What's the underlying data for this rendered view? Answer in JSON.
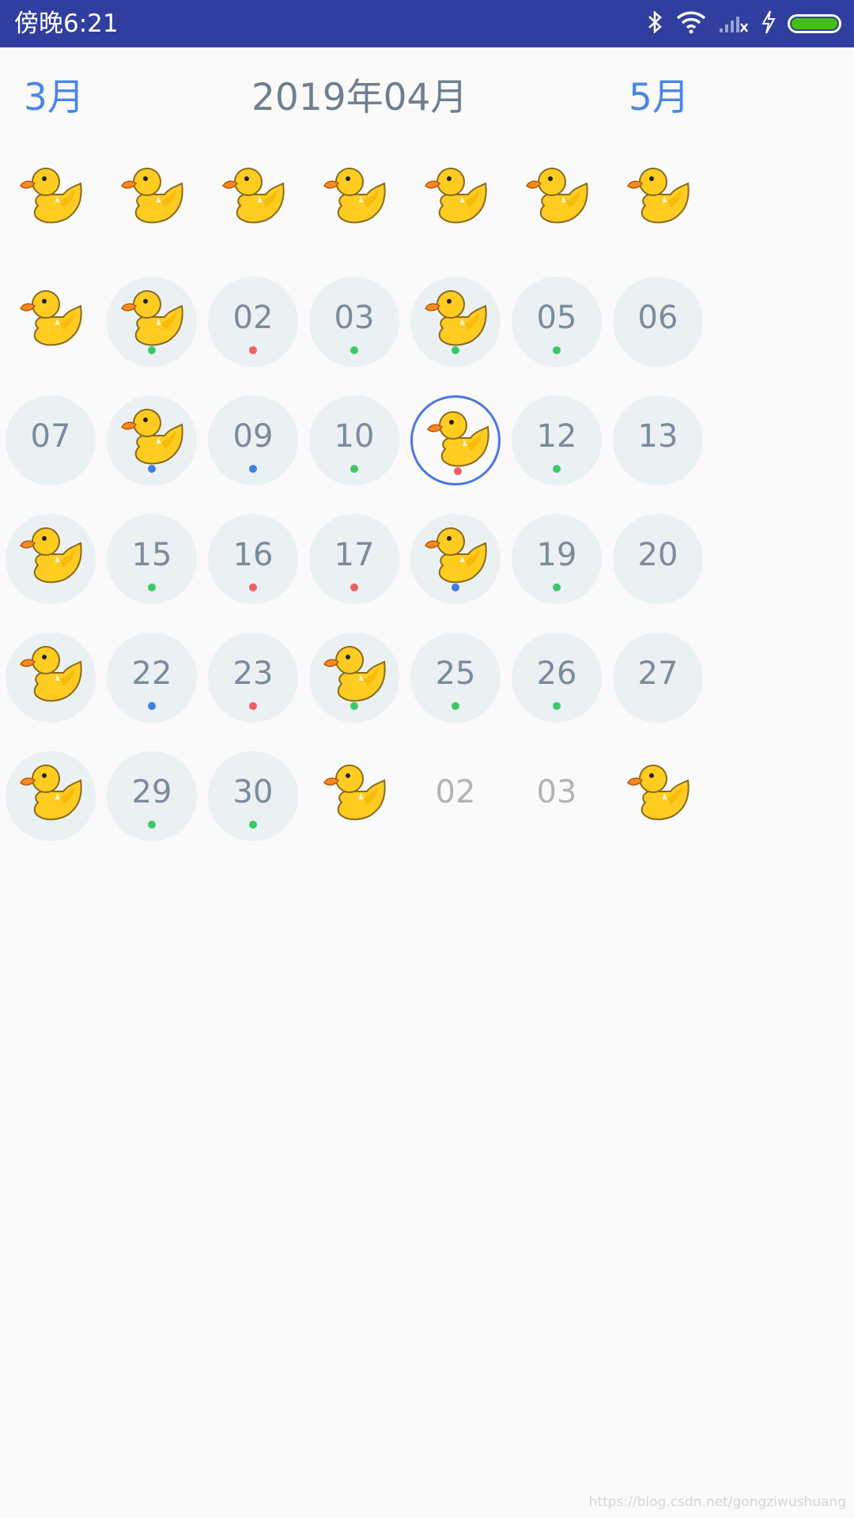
{
  "statusbar": {
    "time": "傍晚6:21",
    "icons": [
      "bluetooth-icon",
      "wifi-icon",
      "no-signal-icon",
      "charging-icon",
      "battery-icon"
    ],
    "battery_color": "#44c010"
  },
  "header": {
    "prev": "3月",
    "title": "2019年04月",
    "next": "5月"
  },
  "colors": {
    "nav": "#4a86e8",
    "title": "#6f7f90",
    "dot_green": "#3cc86a",
    "dot_red": "#ee5f68",
    "dot_blue": "#3f7de8"
  },
  "week_header_icons": [
    "duck-icon",
    "duck-icon",
    "duck-icon",
    "duck-icon",
    "duck-icon",
    "duck-icon",
    "duck-icon"
  ],
  "weeks": [
    [
      {
        "duck": true,
        "bg": false
      },
      {
        "duck": true,
        "bg": true,
        "dot": "green"
      },
      {
        "label": "02",
        "bg": true,
        "dot": "red"
      },
      {
        "label": "03",
        "bg": true,
        "dot": "green"
      },
      {
        "duck": true,
        "bg": true,
        "dot": "green"
      },
      {
        "label": "05",
        "bg": true,
        "dot": "green"
      },
      {
        "label": "06",
        "bg": true
      }
    ],
    [
      {
        "label": "07",
        "bg": true
      },
      {
        "duck": true,
        "bg": true,
        "dot": "blue"
      },
      {
        "label": "09",
        "bg": true,
        "dot": "blue"
      },
      {
        "label": "10",
        "bg": true,
        "dot": "green"
      },
      {
        "duck": true,
        "selected": true,
        "dot": "red"
      },
      {
        "label": "12",
        "bg": true,
        "dot": "green"
      },
      {
        "label": "13",
        "bg": true
      }
    ],
    [
      {
        "duck": true,
        "bg": true
      },
      {
        "label": "15",
        "bg": true,
        "dot": "green"
      },
      {
        "label": "16",
        "bg": true,
        "dot": "red"
      },
      {
        "label": "17",
        "bg": true,
        "dot": "red"
      },
      {
        "duck": true,
        "bg": true,
        "dot": "blue"
      },
      {
        "label": "19",
        "bg": true,
        "dot": "green"
      },
      {
        "label": "20",
        "bg": true
      }
    ],
    [
      {
        "duck": true,
        "bg": true
      },
      {
        "label": "22",
        "bg": true,
        "dot": "blue"
      },
      {
        "label": "23",
        "bg": true,
        "dot": "red"
      },
      {
        "duck": true,
        "bg": true,
        "dot": "green"
      },
      {
        "label": "25",
        "bg": true,
        "dot": "green"
      },
      {
        "label": "26",
        "bg": true,
        "dot": "green"
      },
      {
        "label": "27",
        "bg": true
      }
    ],
    [
      {
        "duck": true,
        "bg": true
      },
      {
        "label": "29",
        "bg": true,
        "dot": "green"
      },
      {
        "label": "30",
        "bg": true,
        "dot": "green"
      },
      {
        "duck": true,
        "bg": false
      },
      {
        "label": "02",
        "bg": false,
        "other": true
      },
      {
        "label": "03",
        "bg": false,
        "other": true
      },
      {
        "duck": true,
        "bg": false
      }
    ]
  ],
  "watermark": "https://blog.csdn.net/gongziwushuang"
}
